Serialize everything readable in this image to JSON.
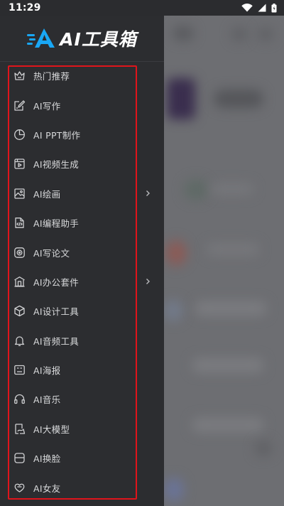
{
  "status_bar": {
    "time": "11:29",
    "icons": [
      "wifi-icon",
      "signal-icon",
      "battery-icon"
    ]
  },
  "drawer": {
    "logo_text": "AI工具箱",
    "accent_color": "#19a7f5",
    "highlight_color": "#e0141b",
    "items": [
      {
        "label": "热门推荐",
        "icon": "crown-icon",
        "has_submenu": false
      },
      {
        "label": "AI写作",
        "icon": "edit-icon",
        "has_submenu": false
      },
      {
        "label": "AI PPT制作",
        "icon": "pie-chart-icon",
        "has_submenu": false
      },
      {
        "label": "AI视频生成",
        "icon": "video-icon",
        "has_submenu": false
      },
      {
        "label": "AI绘画",
        "icon": "image-icon",
        "has_submenu": true
      },
      {
        "label": "AI编程助手",
        "icon": "code-icon",
        "has_submenu": false
      },
      {
        "label": "AI写论文",
        "icon": "paper-icon",
        "has_submenu": false
      },
      {
        "label": "AI办公套件",
        "icon": "office-icon",
        "has_submenu": true
      },
      {
        "label": "AI设计工具",
        "icon": "cube-icon",
        "has_submenu": false
      },
      {
        "label": "AI音频工具",
        "icon": "bell-icon",
        "has_submenu": false
      },
      {
        "label": "AI海报",
        "icon": "poster-icon",
        "has_submenu": false
      },
      {
        "label": "AI音乐",
        "icon": "headphones-icon",
        "has_submenu": false
      },
      {
        "label": "AI大模型",
        "icon": "model-icon",
        "has_submenu": false
      },
      {
        "label": "AI换脸",
        "icon": "face-swap-icon",
        "has_submenu": false
      },
      {
        "label": "AI女友",
        "icon": "heart-chat-icon",
        "has_submenu": false
      }
    ]
  }
}
